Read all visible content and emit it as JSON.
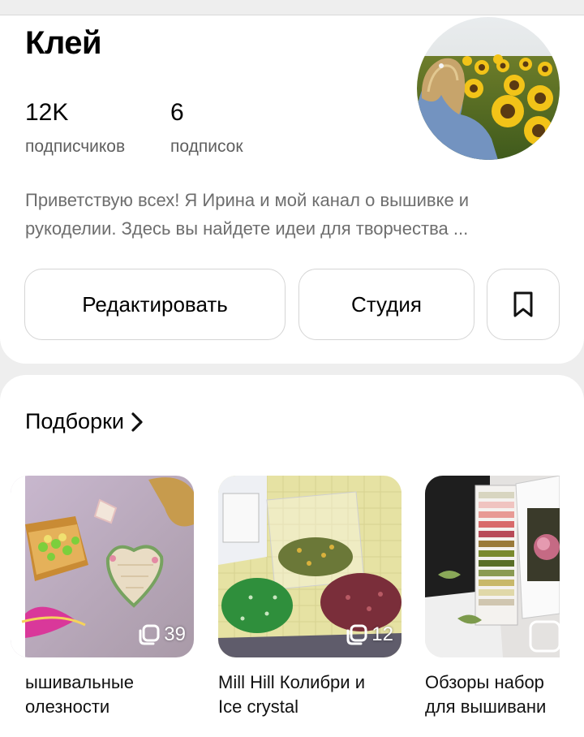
{
  "profile": {
    "name": "Клей",
    "followers_value": "12K",
    "followers_label": "подписчиков",
    "following_value": "6",
    "following_label": "подписок",
    "bio_line1": "Приветствую всех! Я Ирина и мой канал о вышивке и",
    "bio_line2": "рукоделии. Здесь вы найдете идеи для творчества ..."
  },
  "actions": {
    "edit_label": "Редактировать",
    "studio_label": "Студия",
    "bookmark_icon": "bookmark-icon"
  },
  "collections": {
    "title": "Подборки",
    "items": [
      {
        "title_line1": "ышивальные",
        "title_line2": "олезности",
        "count": "39"
      },
      {
        "title_line1": "Mill Hill Колибри и",
        "title_line2": "Ice crystal",
        "count": "12"
      },
      {
        "title_line1": "Обзоры набор",
        "title_line2": "для вышивани",
        "count": ""
      }
    ]
  },
  "colors": {
    "background": "#eeeeee",
    "card": "#ffffff",
    "text_secondary": "#6e6e6e",
    "button_border": "#d5d5d5"
  }
}
